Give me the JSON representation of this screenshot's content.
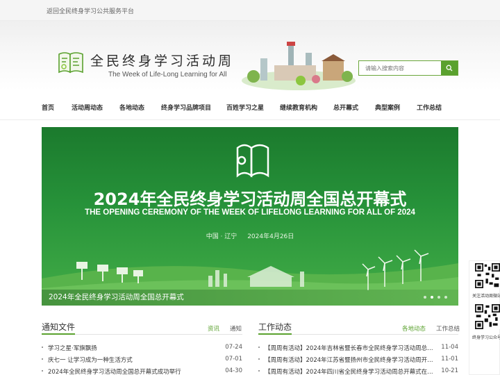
{
  "topbar": {
    "back_link": "返回全民终身学习公共服务平台"
  },
  "header": {
    "title_cn": "全民终身学习活动周",
    "title_en": "The Week of Life-Long Learning for All",
    "search_placeholder": "请输入搜索内容"
  },
  "nav": [
    {
      "label": "首页",
      "active": true
    },
    {
      "label": "活动周动态"
    },
    {
      "label": "各地动态"
    },
    {
      "label": "终身学习品牌项目"
    },
    {
      "label": "百姓学习之星"
    },
    {
      "label": "继续教育机构"
    },
    {
      "label": "总开幕式"
    },
    {
      "label": "典型案例"
    },
    {
      "label": "工作总结"
    }
  ],
  "banner": {
    "title": "2024年全民终身学习活动周全国总开幕式",
    "subtitle": "THE OPENING CEREMONY OF  THE WEEK OF LIFELONG LEARNING FOR ALL OF 2024",
    "location": "中国 · 辽宁",
    "date": "2024年4月26日",
    "caption": "2024年全民终身学习活动周全国总开幕式",
    "slides": 4,
    "active_slide": 2
  },
  "notices": {
    "title": "通知文件",
    "tabs": [
      "资讯",
      "通知"
    ],
    "items": [
      {
        "title": "学习之星·军旗飘扬",
        "date": "07-24"
      },
      {
        "title": "庆七一 让学习成为一种生活方式",
        "date": "07-01"
      },
      {
        "title": "2024年全民终身学习活动周全国总开幕式成功举行",
        "date": "04-30"
      }
    ]
  },
  "work": {
    "title": "工作动态",
    "tabs": [
      "各地动态",
      "工作总结"
    ],
    "items": [
      {
        "title": "【周周有活动】2024年吉林省暨长春市全民终身学习活动周总开...",
        "date": "11-04"
      },
      {
        "title": "【周周有活动】2024年江苏省暨扬州市全民终身学习活动周开幕...",
        "date": "11-01"
      },
      {
        "title": "【周周有活动】2024年四川省全民终身学习活动周总开幕式在自...",
        "date": "10-21"
      }
    ]
  },
  "side_qr": {
    "label1": "关注活动周微站",
    "label2": "终身学习公众号"
  },
  "colors": {
    "accent": "#5aa12e",
    "banner": "#27933a"
  }
}
